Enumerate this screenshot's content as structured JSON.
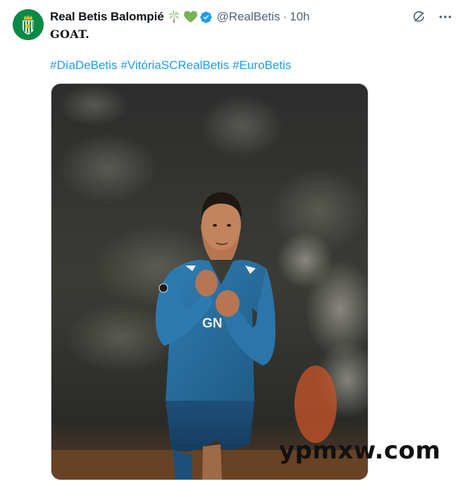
{
  "tweet": {
    "author": {
      "display_name": "Real Betis Balompié",
      "handle": "@RealBetis",
      "avatar_icon": "real-betis-crest-icon",
      "badges": [
        "palm-tree-emoji",
        "green-heart-emoji",
        "verified-badge-icon"
      ]
    },
    "separator": "·",
    "time": "10h",
    "text": "GOAT.",
    "hashtags": [
      "#DíaDeBetis",
      "#VitóriaSCRealBetis",
      "#EuroBetis"
    ],
    "media": {
      "kind": "photo",
      "shirt_text": "GN"
    },
    "actions": {
      "grok_icon": "grok-icon",
      "more_icon": "more-dots-icon"
    }
  },
  "watermark": "ypmxw.com",
  "colors": {
    "text": "#0f1419",
    "secondary": "#536471",
    "link": "#1d9bf0",
    "verified": "#1d9bf0",
    "avatar_bg": "#0a8a45"
  }
}
